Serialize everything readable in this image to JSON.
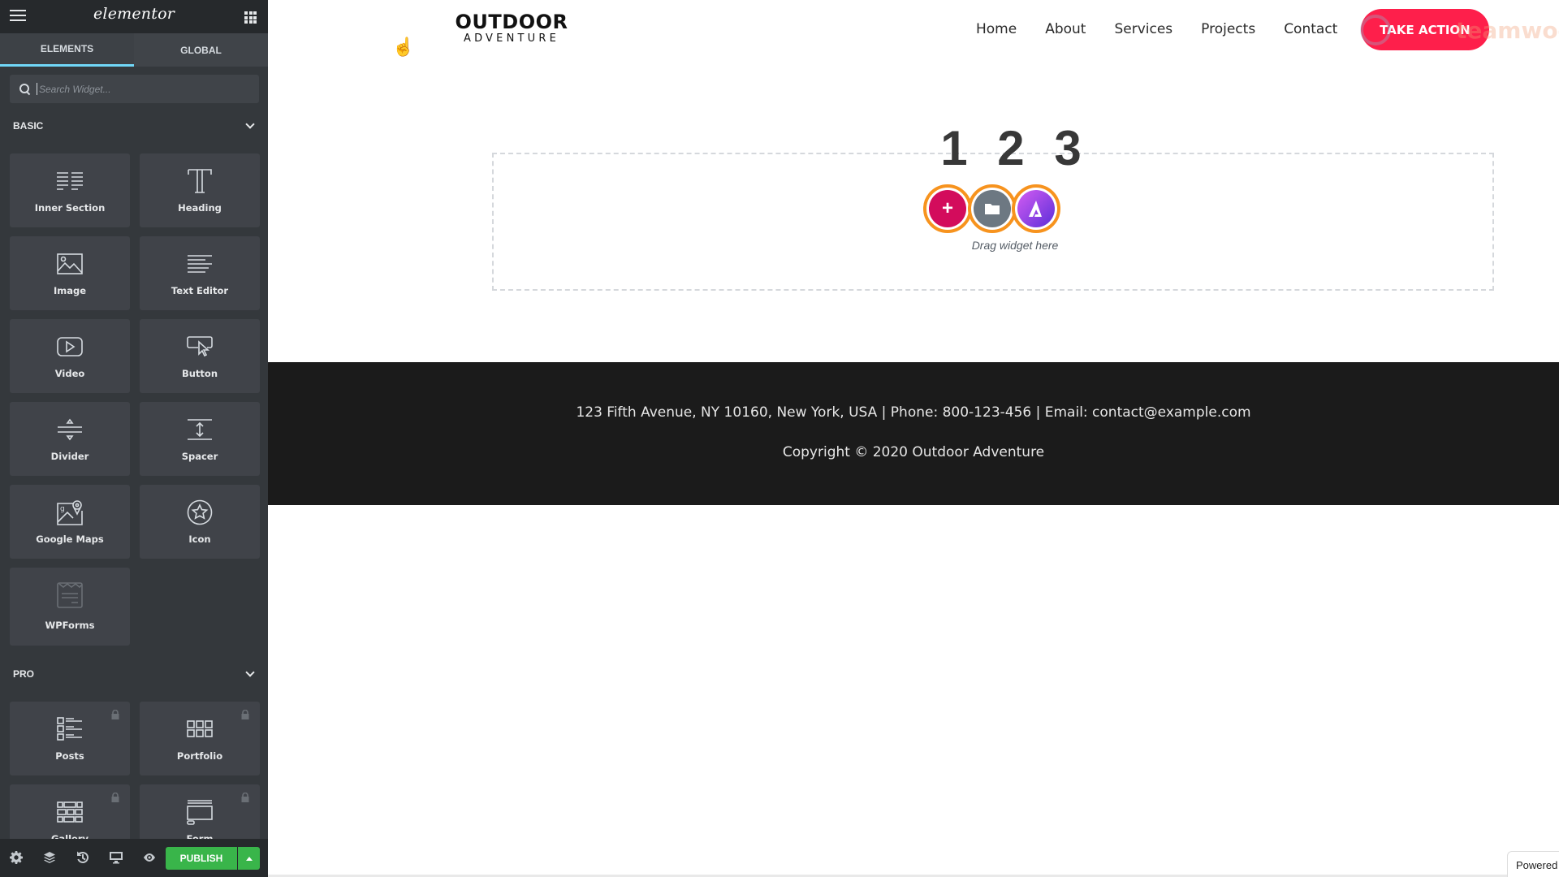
{
  "sidebar": {
    "header": {
      "logo": "elementor",
      "menu_icon": "hamburger-icon",
      "apps_icon": "grid-icon"
    },
    "tabs": [
      {
        "label": "ELEMENTS",
        "active": true
      },
      {
        "label": "GLOBAL",
        "active": false
      }
    ],
    "search": {
      "placeholder": "Search Widget...",
      "value": ""
    },
    "categories": {
      "basic": {
        "label": "BASIC",
        "widgets": [
          {
            "label": "Inner Section",
            "icon": "inner-section-icon"
          },
          {
            "label": "Heading",
            "icon": "heading-icon"
          },
          {
            "label": "Image",
            "icon": "image-icon"
          },
          {
            "label": "Text Editor",
            "icon": "text-editor-icon"
          },
          {
            "label": "Video",
            "icon": "video-icon"
          },
          {
            "label": "Button",
            "icon": "button-icon"
          },
          {
            "label": "Divider",
            "icon": "divider-icon"
          },
          {
            "label": "Spacer",
            "icon": "spacer-icon"
          },
          {
            "label": "Google Maps",
            "icon": "google-maps-icon"
          },
          {
            "label": "Icon",
            "icon": "star-icon"
          },
          {
            "label": "WPForms",
            "icon": "wpforms-icon"
          }
        ]
      },
      "pro": {
        "label": "PRO",
        "widgets": [
          {
            "label": "Posts",
            "icon": "posts-icon",
            "locked": true
          },
          {
            "label": "Portfolio",
            "icon": "portfolio-icon",
            "locked": true
          },
          {
            "label": "Gallery",
            "icon": "gallery-icon",
            "locked": true
          },
          {
            "label": "Form",
            "icon": "form-icon",
            "locked": true
          }
        ]
      }
    },
    "footer": {
      "icons": [
        "settings-icon",
        "navigator-icon",
        "history-icon",
        "responsive-icon",
        "preview-icon"
      ],
      "publish_label": "PUBLISH"
    }
  },
  "canvas": {
    "brand": {
      "top": "OUTDOOR",
      "bottom": "ADVENTURE"
    },
    "nav": [
      "Home",
      "About",
      "Services",
      "Projects",
      "Contact"
    ],
    "cta_label": "TAKE ACTION",
    "watermark": "teamwoo",
    "dropzone": {
      "steps": "1 2 3",
      "hint": "Drag widget here",
      "buttons": [
        "add-section",
        "add-template",
        "astra-starter"
      ]
    },
    "footer": {
      "line1": "123 Fifth Avenue, NY 10160, New York, USA | Phone: 800-123-456 | Email: contact@example.com",
      "line2": "Copyright © 2020 Outdoor Adventure"
    },
    "powered_label": "Powered"
  },
  "colors": {
    "publish": "#39b54a",
    "tab_active_underline": "#71d7f7",
    "cta": "#fe1f4b",
    "add_button": "#d30c5c",
    "highlight_ring": "#f7931e"
  }
}
